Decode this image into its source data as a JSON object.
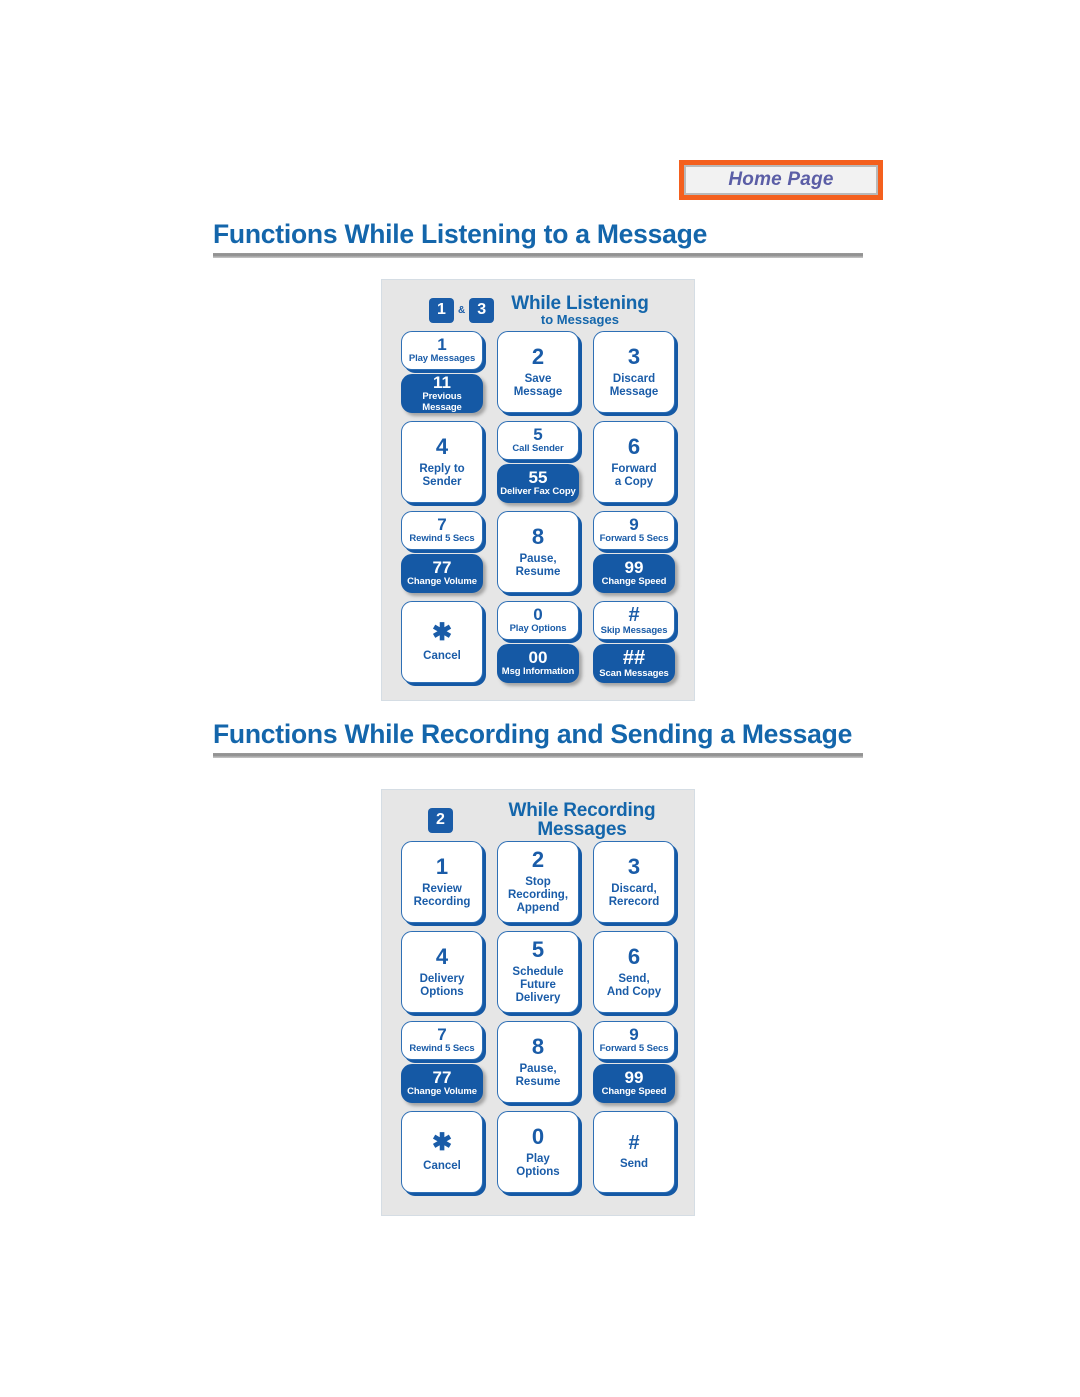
{
  "home_button": {
    "label": "Home Page"
  },
  "sections": [
    {
      "id": "listening",
      "title": "Functions While Listening to a Message"
    },
    {
      "id": "recording",
      "title": "Functions While Recording and Sending a Message"
    }
  ],
  "panels": {
    "listening": {
      "badges": [
        "1",
        "3"
      ],
      "badge_separator": "&",
      "title_line1": "While Listening",
      "title_line2": "to Messages",
      "keys": [
        {
          "primary": {
            "num": "1",
            "label": "Play Messages"
          },
          "secondary": {
            "num": "11",
            "label": "Previous Message"
          }
        },
        {
          "primary": {
            "num": "2",
            "label": "Save\nMessage"
          }
        },
        {
          "primary": {
            "num": "3",
            "label": "Discard\nMessage"
          }
        },
        {
          "primary": {
            "num": "4",
            "label": "Reply to\nSender"
          }
        },
        {
          "primary": {
            "num": "5",
            "label": "Call Sender"
          },
          "secondary": {
            "num": "55",
            "label": "Deliver Fax Copy"
          }
        },
        {
          "primary": {
            "num": "6",
            "label": "Forward\na Copy"
          }
        },
        {
          "primary": {
            "num": "7",
            "label": "Rewind 5 Secs"
          },
          "secondary": {
            "num": "77",
            "label": "Change Volume"
          }
        },
        {
          "primary": {
            "num": "8",
            "label": "Pause,\nResume"
          }
        },
        {
          "primary": {
            "num": "9",
            "label": "Forward 5 Secs"
          },
          "secondary": {
            "num": "99",
            "label": "Change Speed"
          }
        },
        {
          "primary": {
            "num": "✱",
            "label": "Cancel"
          }
        },
        {
          "primary": {
            "num": "0",
            "label": "Play Options"
          },
          "secondary": {
            "num": "00",
            "label": "Msg Information"
          }
        },
        {
          "primary": {
            "num": "#",
            "label": "Skip Messages"
          },
          "secondary": {
            "num": "##",
            "label": "Scan Messages"
          }
        }
      ]
    },
    "recording": {
      "badges": [
        "2"
      ],
      "badge_separator": "",
      "title_line1": "While Recording Messages",
      "title_line2": "",
      "keys": [
        {
          "primary": {
            "num": "1",
            "label": "Review\nRecording"
          }
        },
        {
          "primary": {
            "num": "2",
            "label": "Stop\nRecording,\nAppend"
          }
        },
        {
          "primary": {
            "num": "3",
            "label": "Discard,\nRerecord"
          }
        },
        {
          "primary": {
            "num": "4",
            "label": "Delivery\nOptions"
          }
        },
        {
          "primary": {
            "num": "5",
            "label": "Schedule\nFuture\nDelivery"
          }
        },
        {
          "primary": {
            "num": "6",
            "label": "Send,\nAnd Copy"
          }
        },
        {
          "primary": {
            "num": "7",
            "label": "Rewind 5 Secs"
          },
          "secondary": {
            "num": "77",
            "label": "Change Volume"
          }
        },
        {
          "primary": {
            "num": "8",
            "label": "Pause,\nResume"
          }
        },
        {
          "primary": {
            "num": "9",
            "label": "Forward 5 Secs"
          },
          "secondary": {
            "num": "99",
            "label": "Change Speed"
          }
        },
        {
          "primary": {
            "num": "✱",
            "label": "Cancel"
          }
        },
        {
          "primary": {
            "num": "0",
            "label": "Play\nOptions"
          }
        },
        {
          "primary": {
            "num": "#",
            "label": "Send"
          }
        }
      ]
    }
  },
  "colors": {
    "accent_blue": "#1559a5",
    "heading_blue": "#1466ab",
    "home_border_orange": "#f4601e",
    "home_text_purple": "#5b5ea6",
    "panel_background": "#e6e6e6"
  }
}
